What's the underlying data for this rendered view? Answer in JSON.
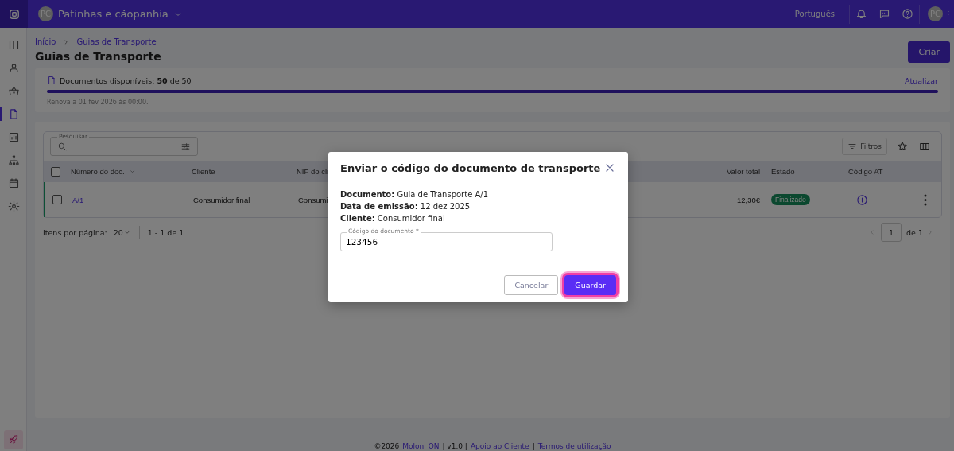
{
  "topbar": {
    "company_initials": "PC",
    "company_name": "Patinhas e cãopanhia",
    "language": "Português",
    "user_initials": "PC"
  },
  "sidebar": {
    "items": [
      {
        "kind": "dashboard",
        "selected": false
      },
      {
        "kind": "person",
        "selected": false
      },
      {
        "kind": "basket",
        "selected": false
      },
      {
        "kind": "document",
        "selected": true
      },
      {
        "kind": "chart",
        "selected": false
      },
      {
        "kind": "network",
        "selected": false
      },
      {
        "kind": "calendar",
        "selected": false
      },
      {
        "kind": "gear",
        "selected": false
      }
    ]
  },
  "breadcrumb": [
    "Início",
    "Guias de Transporte"
  ],
  "title": "Guias de Transporte",
  "create_button": "Criar",
  "quota": {
    "text": "Documentos disponíveis: **50** de 50",
    "level": 1,
    "renew": "Renova a 01 fev 2026 às 00:00.",
    "refresh": "Atualizar"
  },
  "table": {
    "search_label": "Pesquisar",
    "filters": "Filtros",
    "all_selected": false,
    "columns": [
      "Número do doc.",
      "Cliente",
      "NIF do cli",
      "Valor total",
      "Estado",
      "Código AT"
    ],
    "rows": [
      {
        "selected": false,
        "number": "A/1",
        "client": "Consumidor final",
        "nif": "Consumi",
        "total": "12,30€",
        "status": "Finalizado"
      }
    ],
    "items_per_page_label": "Itens por página:",
    "items_per_page": "20",
    "range": "1 - 1 de 1",
    "page": "1",
    "page_total": "de 1"
  },
  "footer": {
    "copyright": "©2026",
    "brand": "Moloni ON",
    "version": "| v1.0 |",
    "support": "Apoio ao Cliente",
    "sep": "|",
    "terms": "Termos de utilização"
  },
  "modal": {
    "title": "Enviar o código do documento de transporte",
    "details": [
      "**Documento:** Guia de Transporte A/1",
      "**Data de emissão:** 12 dez 2025",
      "**Cliente:** Consumidor final"
    ],
    "field_label": "Código do documento *",
    "field_value": "123456",
    "cancel": "Cancelar",
    "save": "Guardar"
  }
}
